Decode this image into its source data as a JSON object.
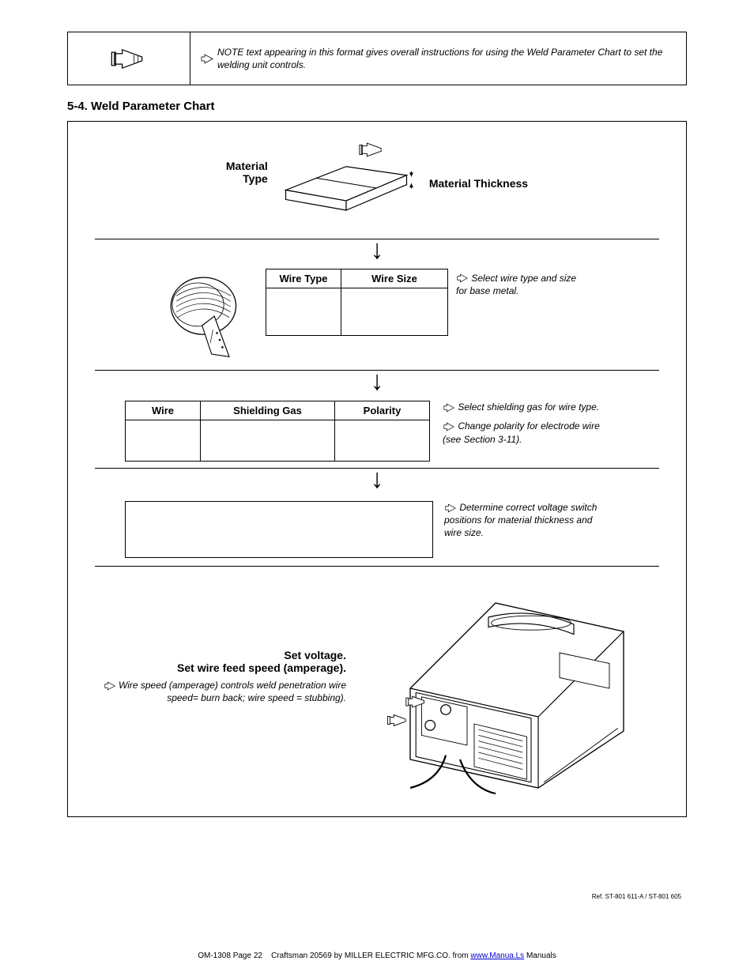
{
  "note_text": " NOTE text appearing in this format gives overall instructions for using the Weld Parameter Chart to set the welding unit controls.",
  "section_heading": "5-4.    Weld Parameter Chart",
  "material": {
    "line1": "Material",
    "line2": "Type",
    "thickness": "Material Thickness"
  },
  "wire": {
    "header_type": "Wire Type",
    "header_size": "Wire Size",
    "note": "Select wire type and size for base metal."
  },
  "gas": {
    "header_wire": "Wire",
    "header_gas": "Shielding Gas",
    "header_polarity": "Polarity",
    "note1": "Select shielding gas for wire type.",
    "note2": "Change polarity for electrode wire (see Section 3-11)."
  },
  "select": {
    "note": "Determine correct voltage switch positions for material thickness and wire size."
  },
  "machine": {
    "line1": "Set voltage.",
    "line2": "Set wire feed speed (amperage).",
    "note": "Wire speed (amperage) controls weld penetration wire speed= burn back; wire speed = stubbing)."
  },
  "refcode": "Ref. ST-801 611-A / ST-801 605",
  "footer": {
    "left": "OM-1308 Page 22",
    "brand": "Craftsman",
    "mid": " 20569 by MILLER ELECTRIC MFG.CO. from ",
    "link": "www.Manua.Ls",
    "tail": " Manuals"
  }
}
